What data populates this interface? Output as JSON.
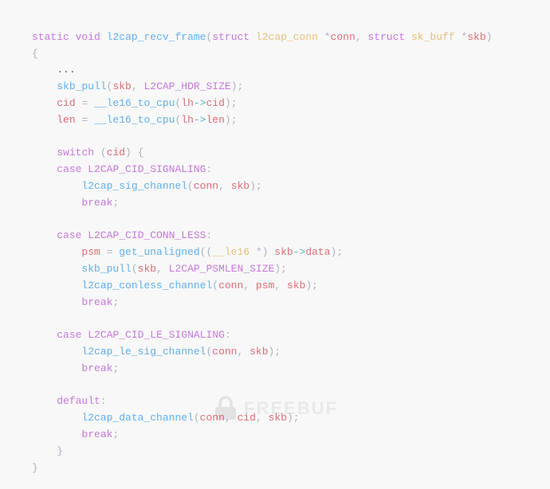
{
  "code": {
    "lines": [
      {
        "id": "line-signature",
        "tokens": [
          {
            "t": "kw",
            "v": "static"
          },
          {
            "t": "plain",
            "v": " "
          },
          {
            "t": "kw",
            "v": "void"
          },
          {
            "t": "plain",
            "v": " "
          },
          {
            "t": "fn",
            "v": "l2cap_recv_frame"
          },
          {
            "t": "plain",
            "v": "("
          },
          {
            "t": "kw",
            "v": "struct"
          },
          {
            "t": "plain",
            "v": " "
          },
          {
            "t": "type",
            "v": "l2cap_conn"
          },
          {
            "t": "plain",
            "v": " *"
          },
          {
            "t": "var",
            "v": "conn"
          },
          {
            "t": "plain",
            "v": ", "
          },
          {
            "t": "kw",
            "v": "struct"
          },
          {
            "t": "plain",
            "v": " "
          },
          {
            "t": "type",
            "v": "sk_buff"
          },
          {
            "t": "plain",
            "v": " *"
          },
          {
            "t": "var",
            "v": "skb"
          },
          {
            "t": "plain",
            "v": ")"
          }
        ]
      },
      {
        "id": "line-open-brace",
        "tokens": [
          {
            "t": "plain",
            "v": "{"
          }
        ]
      },
      {
        "id": "line-ellipsis",
        "tokens": [
          {
            "t": "plain",
            "v": "    "
          },
          {
            "t": "comment",
            "v": "..."
          }
        ]
      },
      {
        "id": "line-skb-pull",
        "tokens": [
          {
            "t": "plain",
            "v": "    "
          },
          {
            "t": "fn",
            "v": "skb_pull"
          },
          {
            "t": "plain",
            "v": "("
          },
          {
            "t": "var",
            "v": "skb"
          },
          {
            "t": "plain",
            "v": ", "
          },
          {
            "t": "macro",
            "v": "L2CAP_HDR_SIZE"
          },
          {
            "t": "plain",
            "v": ");"
          }
        ]
      },
      {
        "id": "line-cid",
        "tokens": [
          {
            "t": "plain",
            "v": "    "
          },
          {
            "t": "var",
            "v": "cid"
          },
          {
            "t": "plain",
            "v": " = "
          },
          {
            "t": "fn",
            "v": "__le16_to_cpu"
          },
          {
            "t": "plain",
            "v": "("
          },
          {
            "t": "var",
            "v": "lh"
          },
          {
            "t": "arrow",
            "v": "->"
          },
          {
            "t": "var",
            "v": "cid"
          },
          {
            "t": "plain",
            "v": ");"
          }
        ]
      },
      {
        "id": "line-len",
        "tokens": [
          {
            "t": "plain",
            "v": "    "
          },
          {
            "t": "var",
            "v": "len"
          },
          {
            "t": "plain",
            "v": " = "
          },
          {
            "t": "fn",
            "v": "__le16_to_cpu"
          },
          {
            "t": "plain",
            "v": "("
          },
          {
            "t": "var",
            "v": "lh"
          },
          {
            "t": "arrow",
            "v": "->"
          },
          {
            "t": "var",
            "v": "len"
          },
          {
            "t": "plain",
            "v": ");"
          }
        ]
      },
      {
        "id": "line-blank1",
        "tokens": []
      },
      {
        "id": "line-switch",
        "tokens": [
          {
            "t": "plain",
            "v": "    "
          },
          {
            "t": "kw",
            "v": "switch"
          },
          {
            "t": "plain",
            "v": " ("
          },
          {
            "t": "var",
            "v": "cid"
          },
          {
            "t": "plain",
            "v": ") {"
          }
        ]
      },
      {
        "id": "line-case1",
        "tokens": [
          {
            "t": "plain",
            "v": "    "
          },
          {
            "t": "kw",
            "v": "case"
          },
          {
            "t": "plain",
            "v": " "
          },
          {
            "t": "macro",
            "v": "L2CAP_CID_SIGNALING"
          },
          {
            "t": "plain",
            "v": ":"
          }
        ]
      },
      {
        "id": "line-sig-call",
        "tokens": [
          {
            "t": "plain",
            "v": "        "
          },
          {
            "t": "fn",
            "v": "l2cap_sig_channel"
          },
          {
            "t": "plain",
            "v": "("
          },
          {
            "t": "var",
            "v": "conn"
          },
          {
            "t": "plain",
            "v": ", "
          },
          {
            "t": "var",
            "v": "skb"
          },
          {
            "t": "plain",
            "v": ");"
          }
        ]
      },
      {
        "id": "line-break1",
        "tokens": [
          {
            "t": "plain",
            "v": "        "
          },
          {
            "t": "kw",
            "v": "break"
          },
          {
            "t": "plain",
            "v": ";"
          }
        ]
      },
      {
        "id": "line-blank2",
        "tokens": []
      },
      {
        "id": "line-case2",
        "tokens": [
          {
            "t": "plain",
            "v": "    "
          },
          {
            "t": "kw",
            "v": "case"
          },
          {
            "t": "plain",
            "v": " "
          },
          {
            "t": "macro",
            "v": "L2CAP_CID_CONN_LESS"
          },
          {
            "t": "plain",
            "v": ":"
          }
        ]
      },
      {
        "id": "line-psm",
        "tokens": [
          {
            "t": "plain",
            "v": "        "
          },
          {
            "t": "var",
            "v": "psm"
          },
          {
            "t": "plain",
            "v": " = "
          },
          {
            "t": "fn",
            "v": "get_unaligned"
          },
          {
            "t": "plain",
            "v": "(("
          },
          {
            "t": "type",
            "v": "__le16"
          },
          {
            "t": "plain",
            "v": " *) "
          },
          {
            "t": "var",
            "v": "skb"
          },
          {
            "t": "arrow",
            "v": "->"
          },
          {
            "t": "var",
            "v": "data"
          },
          {
            "t": "plain",
            "v": ");"
          }
        ]
      },
      {
        "id": "line-skb-pull2",
        "tokens": [
          {
            "t": "plain",
            "v": "        "
          },
          {
            "t": "fn",
            "v": "skb_pull"
          },
          {
            "t": "plain",
            "v": "("
          },
          {
            "t": "var",
            "v": "skb"
          },
          {
            "t": "plain",
            "v": ", "
          },
          {
            "t": "macro",
            "v": "L2CAP_PSMLEN_SIZE"
          },
          {
            "t": "plain",
            "v": ");"
          }
        ]
      },
      {
        "id": "line-conless",
        "tokens": [
          {
            "t": "plain",
            "v": "        "
          },
          {
            "t": "fn",
            "v": "l2cap_conless_channel"
          },
          {
            "t": "plain",
            "v": "("
          },
          {
            "t": "var",
            "v": "conn"
          },
          {
            "t": "plain",
            "v": ", "
          },
          {
            "t": "var",
            "v": "psm"
          },
          {
            "t": "plain",
            "v": ", "
          },
          {
            "t": "var",
            "v": "skb"
          },
          {
            "t": "plain",
            "v": ");"
          }
        ]
      },
      {
        "id": "line-break2",
        "tokens": [
          {
            "t": "plain",
            "v": "        "
          },
          {
            "t": "kw",
            "v": "break"
          },
          {
            "t": "plain",
            "v": ";"
          }
        ]
      },
      {
        "id": "line-blank3",
        "tokens": []
      },
      {
        "id": "line-case3",
        "tokens": [
          {
            "t": "plain",
            "v": "    "
          },
          {
            "t": "kw",
            "v": "case"
          },
          {
            "t": "plain",
            "v": " "
          },
          {
            "t": "macro",
            "v": "L2CAP_CID_LE_SIGNALING"
          },
          {
            "t": "plain",
            "v": ":"
          }
        ]
      },
      {
        "id": "line-le-call",
        "tokens": [
          {
            "t": "plain",
            "v": "        "
          },
          {
            "t": "fn",
            "v": "l2cap_le_sig_channel"
          },
          {
            "t": "plain",
            "v": "("
          },
          {
            "t": "var",
            "v": "conn"
          },
          {
            "t": "plain",
            "v": ", "
          },
          {
            "t": "var",
            "v": "skb"
          },
          {
            "t": "plain",
            "v": ");"
          }
        ]
      },
      {
        "id": "line-break3",
        "tokens": [
          {
            "t": "plain",
            "v": "        "
          },
          {
            "t": "kw",
            "v": "break"
          },
          {
            "t": "plain",
            "v": ";"
          }
        ]
      },
      {
        "id": "line-blank4",
        "tokens": []
      },
      {
        "id": "line-default",
        "tokens": [
          {
            "t": "plain",
            "v": "    "
          },
          {
            "t": "kw",
            "v": "default"
          },
          {
            "t": "plain",
            "v": ":"
          }
        ]
      },
      {
        "id": "line-data-call",
        "tokens": [
          {
            "t": "plain",
            "v": "        "
          },
          {
            "t": "fn",
            "v": "l2cap_data_channel"
          },
          {
            "t": "plain",
            "v": "("
          },
          {
            "t": "var",
            "v": "conn"
          },
          {
            "t": "plain",
            "v": ", "
          },
          {
            "t": "var",
            "v": "cid"
          },
          {
            "t": "plain",
            "v": ", "
          },
          {
            "t": "var",
            "v": "skb"
          },
          {
            "t": "plain",
            "v": ");"
          }
        ]
      },
      {
        "id": "line-break4",
        "tokens": [
          {
            "t": "plain",
            "v": "        "
          },
          {
            "t": "kw",
            "v": "break"
          },
          {
            "t": "plain",
            "v": ";"
          }
        ]
      },
      {
        "id": "line-close-switch",
        "tokens": [
          {
            "t": "plain",
            "v": "    }"
          }
        ]
      },
      {
        "id": "line-close-fn",
        "tokens": [
          {
            "t": "plain",
            "v": "}"
          }
        ]
      }
    ]
  },
  "watermark": {
    "text": "FREEBUF"
  }
}
